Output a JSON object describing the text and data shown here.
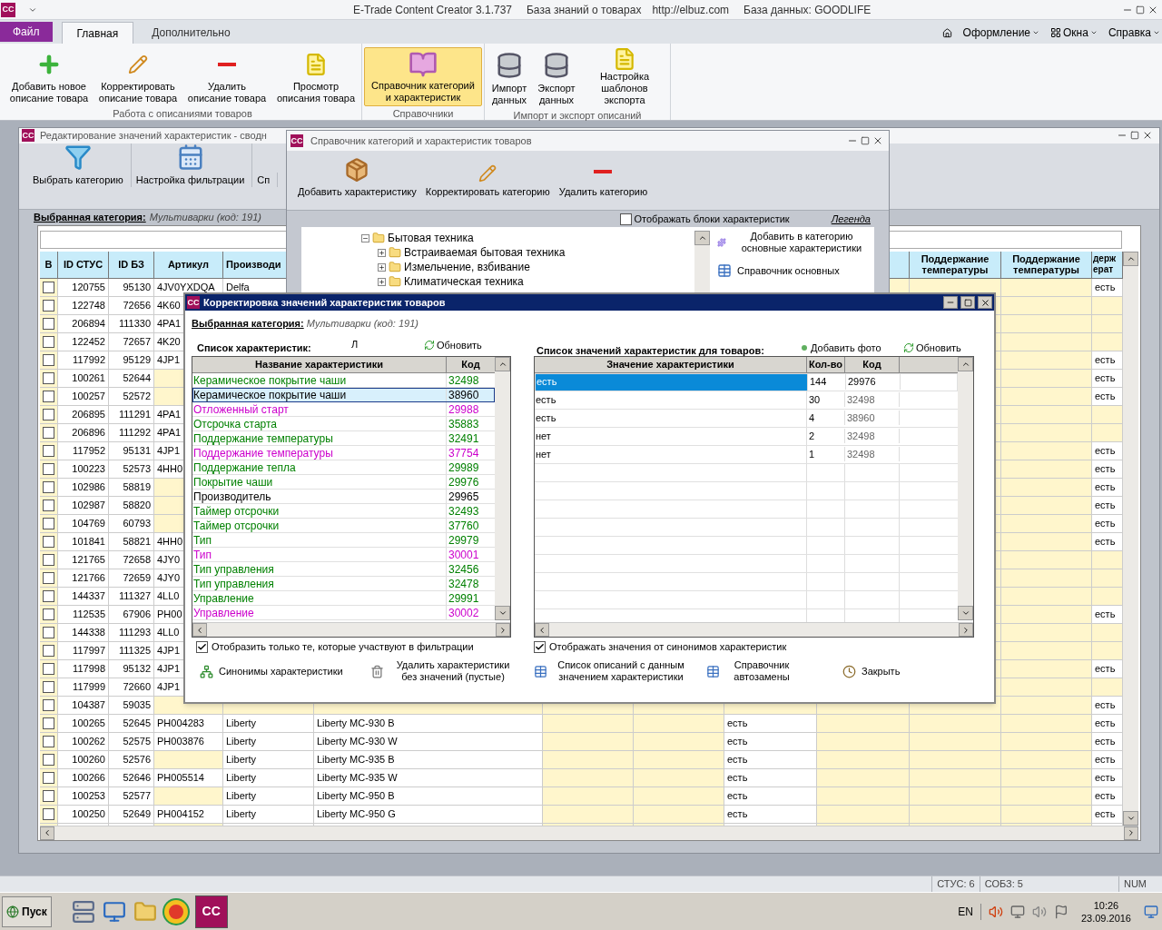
{
  "app_title": {
    "name": "E-Trade Content Creator 3.1.737",
    "knowledge_base": "База знаний о товарах",
    "url": "http://elbuz.com",
    "database": "База данных: GOODLIFE",
    "logo": "CC"
  },
  "ribbon_tabs": [
    {
      "label": "Файл",
      "kind": "file"
    },
    {
      "label": "Главная",
      "kind": "tab",
      "selected": true
    },
    {
      "label": "Дополнительно",
      "kind": "tab",
      "selected": false
    }
  ],
  "ribbon_menus": [
    "Оформление",
    "Окна",
    "Справка"
  ],
  "ribbon_groups": [
    {
      "label": "Работа с описаниями товаров",
      "buttons": [
        {
          "label": "Добавить новое описание товара",
          "selected": false
        },
        {
          "label": "Корректировать описание товара",
          "selected": false
        },
        {
          "label": "Удалить описание товара",
          "selected": false
        },
        {
          "label": "Просмотр описания товара",
          "selected": false
        }
      ]
    },
    {
      "label": "Справочники",
      "buttons": [
        {
          "label": "Справочник категорий и характеристик",
          "selected": true
        }
      ]
    },
    {
      "label": "Импорт и экспорт описаний",
      "buttons": [
        {
          "label": "Импорт данных",
          "selected": false
        },
        {
          "label": "Экспорт данных",
          "selected": false
        },
        {
          "label": "Настройка шаблонов экспорта",
          "selected": false
        }
      ]
    }
  ],
  "editor_window": {
    "title": "Редактирование значений характеристик - сводн",
    "logo": "CC",
    "toolbar": [
      "Выбрать категорию",
      "Настройка фильтрации",
      "Сп"
    ],
    "category_label": "Выбранная категория:",
    "category_value": "Мультиварки (код: 191)",
    "columns_left": [
      "В",
      "ID СТУС",
      "ID БЗ",
      "Артикул",
      "Производи"
    ],
    "columns_right": [
      "Поддержание температуры",
      "Поддержание температуры",
      "держ ерат"
    ],
    "rows": [
      {
        "checked": false,
        "id_stus": "120755",
        "id_bz": "95130",
        "article": "4JV0YXDQA",
        "maker": "Delfa",
        "column_13": "есть"
      },
      {
        "checked": false,
        "id_stus": "122748",
        "id_bz": "72656",
        "article": "4K60"
      },
      {
        "checked": false,
        "id_stus": "206894",
        "id_bz": "111330",
        "article": "4PA1"
      },
      {
        "checked": false,
        "id_stus": "122452",
        "id_bz": "72657",
        "article": "4K20"
      },
      {
        "checked": false,
        "id_stus": "117992",
        "id_bz": "95129",
        "article": "4JP1",
        "column_13": "есть"
      },
      {
        "checked": false,
        "id_stus": "100261",
        "id_bz": "52644",
        "column_13": "есть"
      },
      {
        "checked": false,
        "id_stus": "100257",
        "id_bz": "52572",
        "column_13": "есть"
      },
      {
        "checked": false,
        "id_stus": "206895",
        "id_bz": "111291",
        "article": "4PA1"
      },
      {
        "checked": false,
        "id_stus": "206896",
        "id_bz": "111292",
        "article": "4PA1"
      },
      {
        "checked": false,
        "id_stus": "117952",
        "id_bz": "95131",
        "article": "4JP1",
        "column_13": "есть"
      },
      {
        "checked": false,
        "id_stus": "100223",
        "id_bz": "52573",
        "article": "4HH0",
        "column_13": "есть"
      },
      {
        "checked": false,
        "id_stus": "102986",
        "id_bz": "58819",
        "column_13": "есть"
      },
      {
        "checked": false,
        "id_stus": "102987",
        "id_bz": "58820",
        "column_13": "есть"
      },
      {
        "checked": false,
        "id_stus": "104769",
        "id_bz": "60793",
        "column_13": "есть"
      },
      {
        "checked": false,
        "id_stus": "101841",
        "id_bz": "58821",
        "article": "4HH0",
        "column_13": "есть"
      },
      {
        "checked": false,
        "id_stus": "121765",
        "id_bz": "72658",
        "article": "4JY0"
      },
      {
        "checked": false,
        "id_stus": "121766",
        "id_bz": "72659",
        "article": "4JY0"
      },
      {
        "checked": false,
        "id_stus": "144337",
        "id_bz": "111327",
        "article": "4LL0"
      },
      {
        "checked": false,
        "id_stus": "112535",
        "id_bz": "67906",
        "article": "PH00",
        "column_13": "есть"
      },
      {
        "checked": false,
        "id_stus": "144338",
        "id_bz": "111293",
        "article": "4LL0"
      },
      {
        "checked": false,
        "id_stus": "117997",
        "id_bz": "111325",
        "article": "4JP1"
      },
      {
        "checked": false,
        "id_stus": "117998",
        "id_bz": "95132",
        "article": "4JP1",
        "column_13": "есть"
      },
      {
        "checked": false,
        "id_stus": "117999",
        "id_bz": "72660",
        "article": "4JP1"
      },
      {
        "checked": false,
        "id_stus": "104387",
        "id_bz": "59035",
        "column_13": "есть"
      },
      {
        "checked": false,
        "id_stus": "100265",
        "id_bz": "52645",
        "article": "PH004283",
        "maker": "Liberty",
        "name": "Liberty MC-930 B",
        "column_9": "есть",
        "column_13": "есть"
      },
      {
        "checked": false,
        "id_stus": "100262",
        "id_bz": "52575",
        "article": "PH003876",
        "maker": "Liberty",
        "name": "Liberty MC-930 W",
        "column_9": "есть",
        "column_13": "есть"
      },
      {
        "checked": false,
        "id_stus": "100260",
        "id_bz": "52576",
        "maker": "Liberty",
        "name": "Liberty MC-935 B",
        "column_9": "есть",
        "column_13": "есть"
      },
      {
        "checked": false,
        "id_stus": "100266",
        "id_bz": "52646",
        "article": "PH005514",
        "maker": "Liberty",
        "name": "Liberty MC-935 W",
        "column_9": "есть",
        "column_13": "есть"
      },
      {
        "checked": false,
        "id_stus": "100253",
        "id_bz": "52577",
        "maker": "Liberty",
        "name": "Liberty MC-950 B",
        "column_9": "есть",
        "column_13": "есть"
      },
      {
        "checked": false,
        "id_stus": "100250",
        "id_bz": "52649",
        "article": "PH004152",
        "maker": "Liberty",
        "name": "Liberty MC-950 G",
        "column_9": "есть",
        "column_13": "есть"
      }
    ]
  },
  "catalog_window": {
    "title": "Справочник категорий и характеристик товаров",
    "logo": "CC",
    "toolbar": [
      "Добавить характеристику",
      "Корректировать категорию",
      "Удалить категорию"
    ],
    "show_blocks": {
      "label": "Отображать блоки характеристик",
      "checked": false
    },
    "legend": "Легенда",
    "tree": [
      {
        "label": "Бытовая техника",
        "expanded": true,
        "children": [
          {
            "label": "Встраиваемая бытовая техника",
            "expanded": false
          },
          {
            "label": "Измельчение, взбивание",
            "expanded": false
          },
          {
            "label": "Климатическая техника",
            "expanded": false
          }
        ]
      }
    ],
    "side_actions": [
      "Добавить в категорию основные характеристики",
      "Справочник основных"
    ]
  },
  "dialog": {
    "title": "Корректировка значений характеристик товаров",
    "logo": "CC",
    "category_label": "Выбранная категория:",
    "category_value": "Мультиварки (код: 191)",
    "left_title": "Список характеристик:",
    "left_marker": "Л",
    "left_refresh": "Обновить",
    "left_columns": [
      "Название характеристики",
      "Код"
    ],
    "characteristics": [
      {
        "name": "Керамическое покрытие чаши",
        "code": "32498",
        "color": "#008000",
        "selected": false
      },
      {
        "name": "Керамическое покрытие чаши",
        "code": "38960",
        "color": "#000000",
        "selected": true
      },
      {
        "name": "Отложенный старт",
        "code": "29988",
        "color": "#cc00cc",
        "selected": false
      },
      {
        "name": "Отсрочка старта",
        "code": "35883",
        "color": "#008000",
        "selected": false
      },
      {
        "name": "Поддержание температуры",
        "code": "32491",
        "color": "#008000",
        "selected": false
      },
      {
        "name": "Поддержание температуры",
        "code": "37754",
        "color": "#cc00cc",
        "selected": false
      },
      {
        "name": "Поддержание тепла",
        "code": "29989",
        "color": "#008000",
        "selected": false
      },
      {
        "name": "Покрытие чаши",
        "code": "29976",
        "color": "#008000",
        "selected": false
      },
      {
        "name": "Производитель",
        "code": "29965",
        "color": "#000000",
        "selected": false
      },
      {
        "name": "Таймер отсрочки",
        "code": "32493",
        "color": "#008000",
        "selected": false
      },
      {
        "name": "Таймер отсрочки",
        "code": "37760",
        "color": "#008000",
        "selected": false
      },
      {
        "name": "Тип",
        "code": "29979",
        "color": "#008000",
        "selected": false
      },
      {
        "name": "Тип",
        "code": "30001",
        "color": "#cc00cc",
        "selected": false
      },
      {
        "name": "Тип управления",
        "code": "32456",
        "color": "#008000",
        "selected": false
      },
      {
        "name": "Тип управления",
        "code": "32478",
        "color": "#008000",
        "selected": false
      },
      {
        "name": "Управление",
        "code": "29991",
        "color": "#008000",
        "selected": false
      },
      {
        "name": "Управление",
        "code": "30002",
        "color": "#cc00cc",
        "selected": false
      }
    ],
    "right_title": "Список значений характеристик для товаров:",
    "add_photo": "Добавить фото",
    "right_refresh": "Обновить",
    "right_columns": [
      "Значение характеристики",
      "Кол-во",
      "Код"
    ],
    "values": [
      {
        "value": "есть",
        "count": "144",
        "code": "29976",
        "selected": true
      },
      {
        "value": "есть",
        "count": "30",
        "code": "32498",
        "selected": false
      },
      {
        "value": "есть",
        "count": "4",
        "code": "38960",
        "selected": false
      },
      {
        "value": "нет",
        "count": "2",
        "code": "32498",
        "selected": false
      },
      {
        "value": "нет",
        "count": "1",
        "code": "32498",
        "selected": false
      }
    ],
    "left_filter": {
      "label": "Отобразить только те, которые участвуют в фильтрации",
      "checked": true
    },
    "right_filter": {
      "label": "Отображать значения от синонимов характеристик",
      "checked": true
    },
    "buttons": [
      "Синонимы характеристики",
      "Удалить характеристики без значений (пустые)",
      "Список описаний с данным значением характеристики",
      "Справочник автозамены",
      "Закрыть"
    ]
  },
  "status_bar": [
    "СТУС: 6",
    "СОБЗ: 5",
    "NUM"
  ],
  "taskbar": {
    "start": "Пуск",
    "app_label": "CC",
    "language": "EN",
    "time": "10:26",
    "date": "23.09.2016"
  }
}
